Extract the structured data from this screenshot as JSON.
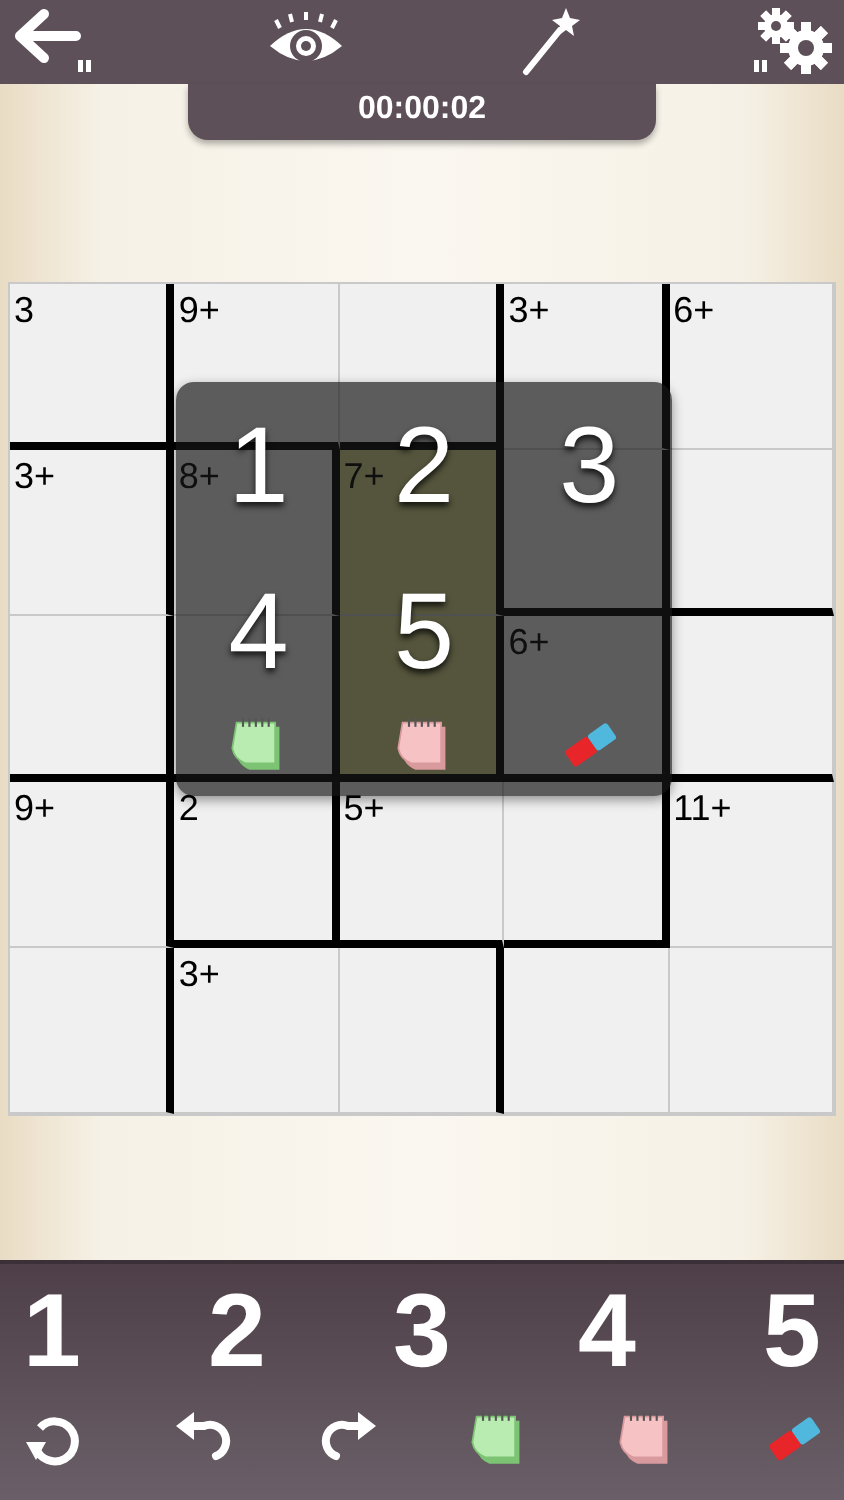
{
  "timer": "00:00:02",
  "grid": {
    "rows": [
      [
        {
          "label": "3",
          "selected": false,
          "thick_right": true,
          "thick_bottom": true
        },
        {
          "label": "9+",
          "selected": false,
          "thick_right": false,
          "thick_bottom": true
        },
        {
          "selected": false,
          "thick_right": true,
          "thick_bottom": true
        },
        {
          "label": "3+",
          "selected": false,
          "thick_right": true,
          "thick_bottom": false
        },
        {
          "label": "6+",
          "selected": false,
          "thick_right": false,
          "thick_bottom": false
        }
      ],
      [
        {
          "label": "3+",
          "selected": false,
          "thick_right": true,
          "thick_bottom": false
        },
        {
          "label": "8+",
          "selected": false,
          "thick_right": true,
          "thick_bottom": false
        },
        {
          "label": "7+",
          "selected": true,
          "thick_right": true,
          "thick_bottom": false
        },
        {
          "selected": false,
          "thick_right": true,
          "thick_bottom": true
        },
        {
          "selected": false,
          "thick_right": false,
          "thick_bottom": true
        }
      ],
      [
        {
          "selected": false,
          "thick_right": true,
          "thick_bottom": true
        },
        {
          "selected": false,
          "thick_right": true,
          "thick_bottom": true
        },
        {
          "selected": true,
          "thick_right": true,
          "thick_bottom": true
        },
        {
          "label": "6+",
          "selected": false,
          "thick_right": true,
          "thick_bottom": true
        },
        {
          "selected": false,
          "thick_right": false,
          "thick_bottom": true
        }
      ],
      [
        {
          "label": "9+",
          "selected": false,
          "thick_right": true,
          "thick_bottom": false
        },
        {
          "label": "2",
          "selected": false,
          "thick_right": true,
          "thick_bottom": true
        },
        {
          "label": "5+",
          "selected": false,
          "thick_right": false,
          "thick_bottom": true
        },
        {
          "selected": false,
          "thick_right": true,
          "thick_bottom": true
        },
        {
          "label": "11+",
          "selected": false,
          "thick_right": false,
          "thick_bottom": false
        }
      ],
      [
        {
          "selected": false,
          "thick_right": true,
          "thick_bottom": false
        },
        {
          "label": "3+",
          "selected": false,
          "thick_right": false,
          "thick_bottom": false
        },
        {
          "selected": false,
          "thick_right": true,
          "thick_bottom": false
        },
        {
          "selected": false,
          "thick_right": false,
          "thick_bottom": false
        },
        {
          "selected": false,
          "thick_right": false,
          "thick_bottom": false
        }
      ]
    ]
  },
  "popup": {
    "digits": [
      "1",
      "2",
      "3",
      "4",
      "5"
    ]
  },
  "keypad": {
    "digits": [
      "1",
      "2",
      "3",
      "4",
      "5"
    ]
  }
}
